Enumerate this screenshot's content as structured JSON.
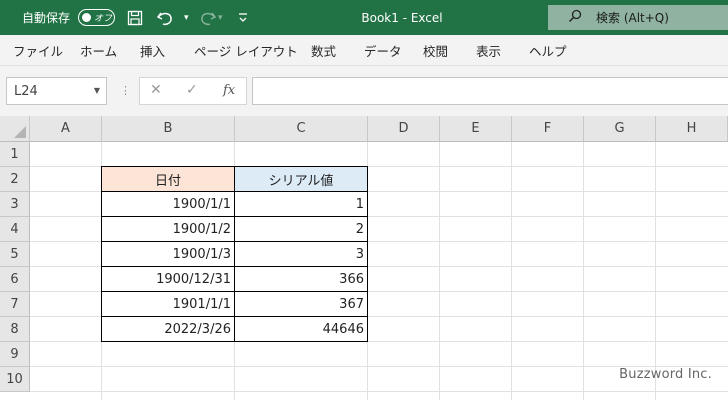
{
  "titlebar": {
    "autosave_label": "自動保存",
    "autosave_state": "オフ",
    "document_title": "Book1  -  Excel",
    "search_placeholder": "検索 (Alt+Q)",
    "icons": [
      "save-icon",
      "undo-icon",
      "redo-icon",
      "customize-qat-icon",
      "search-icon"
    ]
  },
  "ribbon_tabs": [
    "ファイル",
    "ホーム",
    "挿入",
    "ページ レイアウト",
    "数式",
    "データ",
    "校閲",
    "表示",
    "ヘルプ"
  ],
  "formula_bar": {
    "name_box": "L24",
    "cancel_symbol": "✕",
    "enter_symbol": "✓",
    "fx_symbol": "fx",
    "formula_value": ""
  },
  "columns": [
    "A",
    "B",
    "C",
    "D",
    "E",
    "F",
    "G",
    "H"
  ],
  "rows": [
    "1",
    "2",
    "3",
    "4",
    "5",
    "6",
    "7",
    "8",
    "9",
    "10"
  ],
  "table": {
    "header_date": "日付",
    "header_serial": "シリアル値",
    "header_date_bg": "#fce4d6",
    "header_serial_bg": "#ddebf7",
    "rows": [
      {
        "date": "1900/1/1",
        "serial": "1"
      },
      {
        "date": "1900/1/2",
        "serial": "2"
      },
      {
        "date": "1900/1/3",
        "serial": "3"
      },
      {
        "date": "1900/12/31",
        "serial": "366"
      },
      {
        "date": "1901/1/1",
        "serial": "367"
      },
      {
        "date": "2022/3/26",
        "serial": "44646"
      }
    ]
  },
  "watermark": "Buzzword Inc.",
  "colors": {
    "titlebar": "#217346",
    "search_bg": "#8fb3a0"
  }
}
